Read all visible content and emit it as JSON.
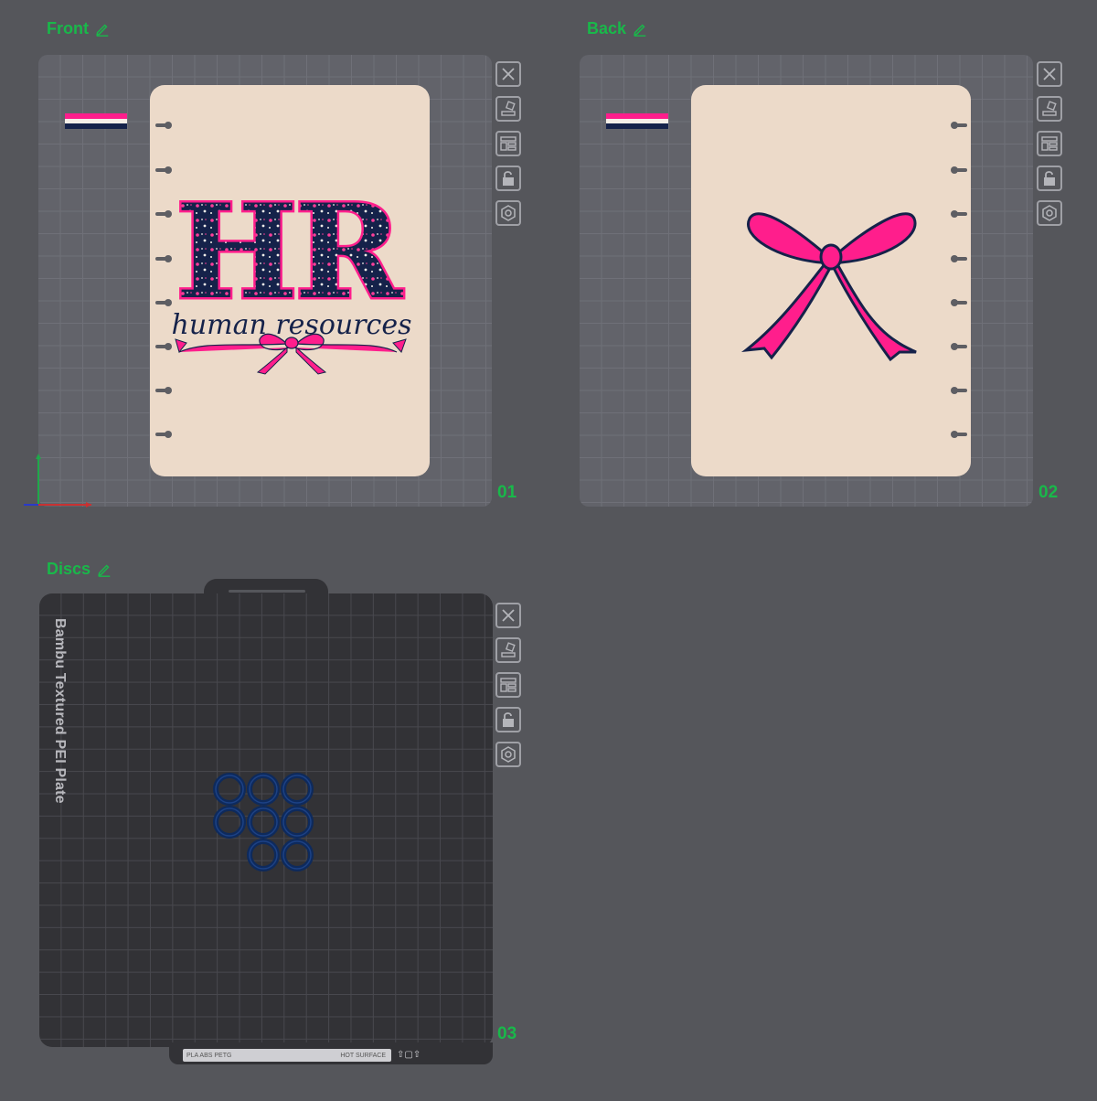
{
  "plates": [
    {
      "title": "Front",
      "number": "01"
    },
    {
      "title": "Back",
      "number": "02"
    },
    {
      "title": "Discs",
      "number": "03"
    }
  ],
  "front_art": {
    "big": "HR",
    "script": "human resources"
  },
  "bed_label": "Bambu Textured PEI Plate",
  "strip": {
    "filaments": "PLA ABS PETG",
    "hot_surface": "HOT SURFACE"
  },
  "toolbar_icons": [
    "close-icon",
    "auto-orient-icon",
    "arrange-icon",
    "lock-icon",
    "settings-icon"
  ],
  "colors": {
    "accent_green": "#19b84a",
    "cover_cream": "#ecdac9",
    "pink": "#ff1e8c",
    "navy": "#15224a",
    "disc_blue": "#0e2a5c"
  }
}
